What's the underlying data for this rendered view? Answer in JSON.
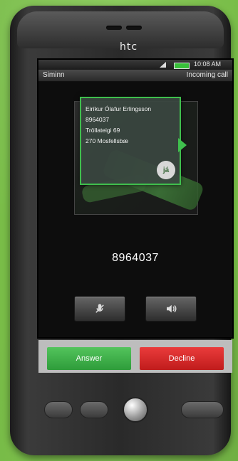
{
  "phone": {
    "brand": "htc"
  },
  "status_bar": {
    "time": "10:08 AM",
    "icons": [
      "signal-icon",
      "battery-icon"
    ]
  },
  "call_header": {
    "carrier": "Siminn",
    "state": "Incoming call"
  },
  "caller_popup": {
    "lines": [
      "Eiríkur Ólafur Erlingsson",
      "8964037",
      "Tröllateigi 69",
      "270 Mosfellsbæ"
    ],
    "badge": "já"
  },
  "caller_number": "8964037",
  "controls": {
    "mute_icon": "mute-microphone-icon",
    "speaker_icon": "speaker-icon"
  },
  "actions": {
    "answer": "Answer",
    "decline": "Decline"
  },
  "colors": {
    "accent_green": "#3fbf4d",
    "answer_green": "#39ad43",
    "decline_red": "#d62a2a",
    "background_green": "#7cc04a"
  }
}
